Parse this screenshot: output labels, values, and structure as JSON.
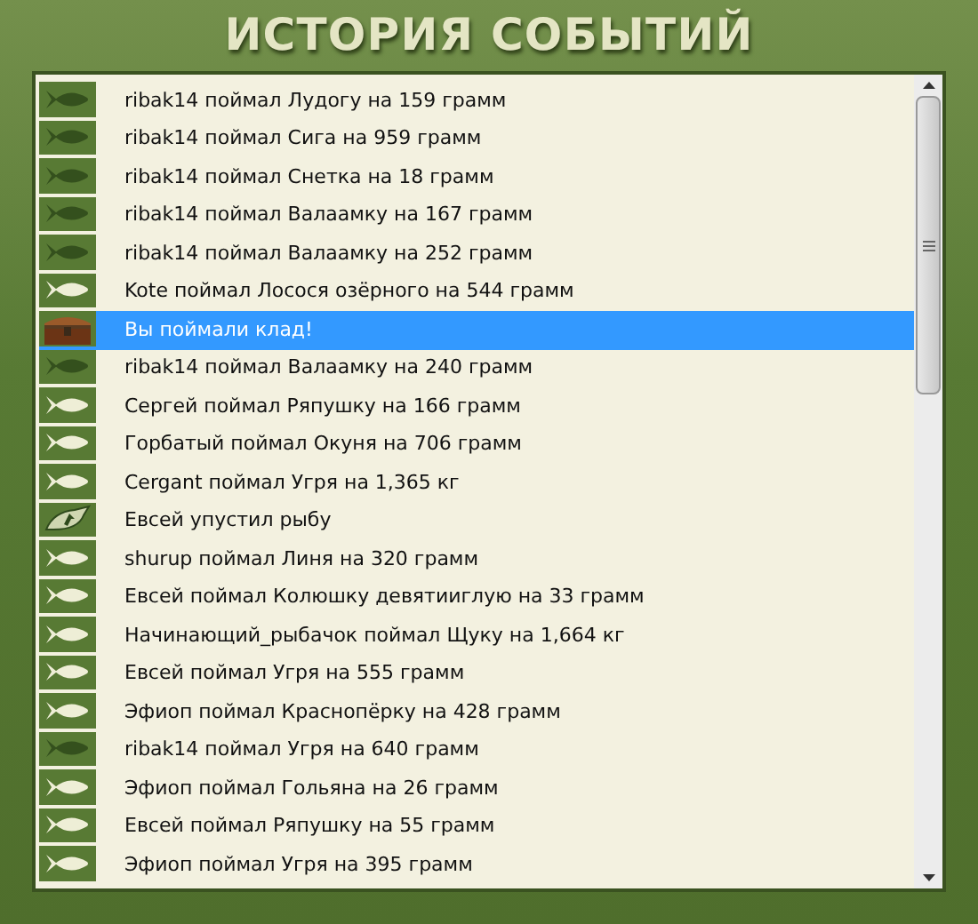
{
  "window": {
    "title": "ИСТОРИЯ СОБЫТИЙ"
  },
  "events": [
    {
      "kind": "fish_dark",
      "text": "ribak14 поймал Лудогу на 159 грамм",
      "selected": false
    },
    {
      "kind": "fish_dark",
      "text": "ribak14 поймал Сига на 959 грамм",
      "selected": false
    },
    {
      "kind": "fish_dark",
      "text": "ribak14 поймал Снетка на 18 грамм",
      "selected": false
    },
    {
      "kind": "fish_dark",
      "text": "ribak14 поймал Валаамку на 167 грамм",
      "selected": false
    },
    {
      "kind": "fish_dark",
      "text": "ribak14 поймал Валаамку на 252 грамм",
      "selected": false
    },
    {
      "kind": "fish_light",
      "text": "Kote поймал Лосося озёрного на 544 грамм",
      "selected": false
    },
    {
      "kind": "treasure",
      "text": "Вы поймали клад!",
      "selected": true
    },
    {
      "kind": "fish_dark",
      "text": "ribak14 поймал Валаамку на 240 грамм",
      "selected": false
    },
    {
      "kind": "fish_light",
      "text": "Сергей поймал Ряпушку на 166 грамм",
      "selected": false
    },
    {
      "kind": "fish_light",
      "text": "Горбатый поймал Окуня на 706 грамм",
      "selected": false
    },
    {
      "kind": "fish_light",
      "text": "Cergant поймал Угря на 1,365 кг",
      "selected": false
    },
    {
      "kind": "escaped",
      "text": "Евсей упустил рыбу",
      "selected": false
    },
    {
      "kind": "fish_light",
      "text": "shurup поймал Линя на 320 грамм",
      "selected": false
    },
    {
      "kind": "fish_light",
      "text": "Евсей поймал Колюшку девятииглую на 33 грамм",
      "selected": false
    },
    {
      "kind": "fish_light",
      "text": "Начинающий_рыбачок поймал Щуку на 1,664 кг",
      "selected": false
    },
    {
      "kind": "fish_light",
      "text": "Евсей поймал Угря на 555 грамм",
      "selected": false
    },
    {
      "kind": "fish_light",
      "text": "Эфиоп поймал Краснопёрку на 428 грамм",
      "selected": false
    },
    {
      "kind": "fish_dark",
      "text": "ribak14 поймал Угря на 640 грамм",
      "selected": false
    },
    {
      "kind": "fish_light",
      "text": "Эфиоп поймал Гольяна на 26 грамм",
      "selected": false
    },
    {
      "kind": "fish_light",
      "text": "Евсей поймал Ряпушку на 55 грамм",
      "selected": false
    },
    {
      "kind": "fish_light",
      "text": "Эфиоп поймал Угря на 395 грамм",
      "selected": false
    }
  ]
}
